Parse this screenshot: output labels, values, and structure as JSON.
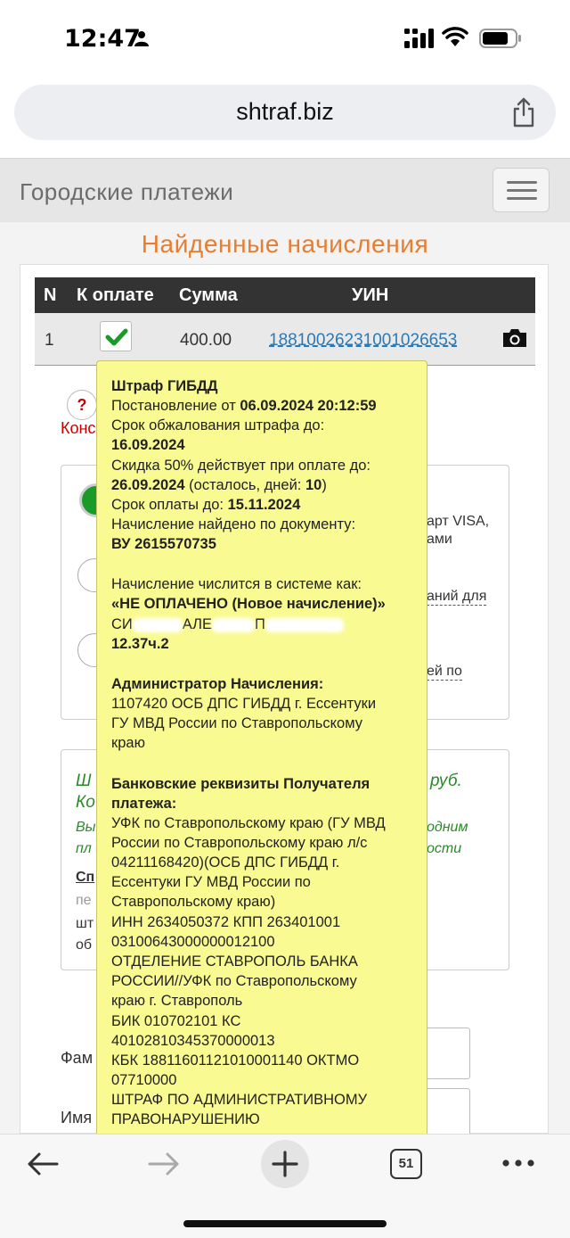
{
  "status_bar": {
    "time": "12:47",
    "icons": [
      "person-icon",
      "signal-icon",
      "wifi-icon",
      "battery-icon"
    ]
  },
  "browser": {
    "url": "shtraf.biz",
    "tab_count": "51"
  },
  "site": {
    "title": "Городские платежи"
  },
  "page": {
    "heading": "Найденные начисления",
    "table": {
      "headers": [
        "N",
        "К оплате",
        "Сумма",
        "УИН"
      ],
      "row": {
        "n": "1",
        "amount": "400.00",
        "uin": "18810026231001026653"
      }
    },
    "background": {
      "help_symbol": "?",
      "konv_fragment": "Конс",
      "option1_right_line1": "арт VISA,",
      "option1_right_line2": "ами",
      "option2_right": "аний для",
      "option3_right": "ей по",
      "summary_line1_left": "Ш",
      "summary_line1_right": "руб.",
      "summary_line2_left": "Ко",
      "summary_line3_left": "Вы",
      "summary_line3_right": "одним",
      "summary_line4_left": "пл",
      "summary_line4_right": "ости",
      "summary_line5_left": "Сп",
      "summary_line6_left": "пе",
      "summary_line7_left": "шт",
      "summary_line8_left": "об",
      "field_surname_fragment": "Фам",
      "field_name_fragment": "Имя"
    },
    "tooltip": {
      "title": "Штраф ГИБДД",
      "decree_label": "Постановление от ",
      "decree_date": "06.09.2024 20:12:59",
      "appeal_label": "Срок обжалования штрафа до:",
      "appeal_date": "16.09.2024",
      "discount_label": "Скидка 50% действует при оплате до:",
      "discount_date": "26.09.2024",
      "days_left_prefix": " (осталось, дней: ",
      "days_left": "10",
      "days_left_suffix": ")",
      "due_label": "Срок оплаты до: ",
      "due_date": "15.11.2024",
      "found_label": "Начисление найдено по документу:",
      "found_doc": "ВУ 2615570735",
      "status_label": "Начисление числится в системе как:",
      "status_value": "«НЕ ОПЛАЧЕНО (Новое начисление)»",
      "name_part1": "СИ",
      "name_part2": "АЛЕ",
      "name_part3": "П",
      "article": "12.37ч.2",
      "admin_title": "Администратор Начисления:",
      "admin_line1": "1107420 ОСБ ДПС ГИБДД г. Ессентуки",
      "admin_line2": "ГУ МВД России по Ставропольскому",
      "admin_line3": "краю",
      "bank_title_line1": "Банковские реквизиты Получателя",
      "bank_title_line2": "платежа:",
      "bank_lines": [
        "УФК по Ставропольскому краю (ГУ МВД",
        "России по Ставропольскому краю л/с",
        "04211168420)(ОСБ ДПС ГИБДД г.",
        "Ессентуки ГУ МВД России по",
        "Ставропольскому краю)",
        "ИНН 2634050372 КПП 263401001",
        "03100643000000012100",
        "ОТДЕЛЕНИЕ СТАВРОПОЛЬ БАНКА",
        "РОССИИ//УФК по Ставропольскому",
        "краю г. Ставрополь",
        "БИК 010702101 КС",
        "40102810345370000013",
        "КБК 18811601121010001140 ОКТМО",
        "07710000",
        "ШТРАФ ПО АДМИНИСТРАТИВНОМУ",
        "ПРАВОНАРУШЕНИЮ"
      ]
    }
  },
  "colors": {
    "heading_orange": "#e87d2e",
    "tooltip_yellow": "#fafa92",
    "link_blue": "#2a7ab8",
    "check_green": "#1a9a26",
    "table_header": "#333333"
  }
}
